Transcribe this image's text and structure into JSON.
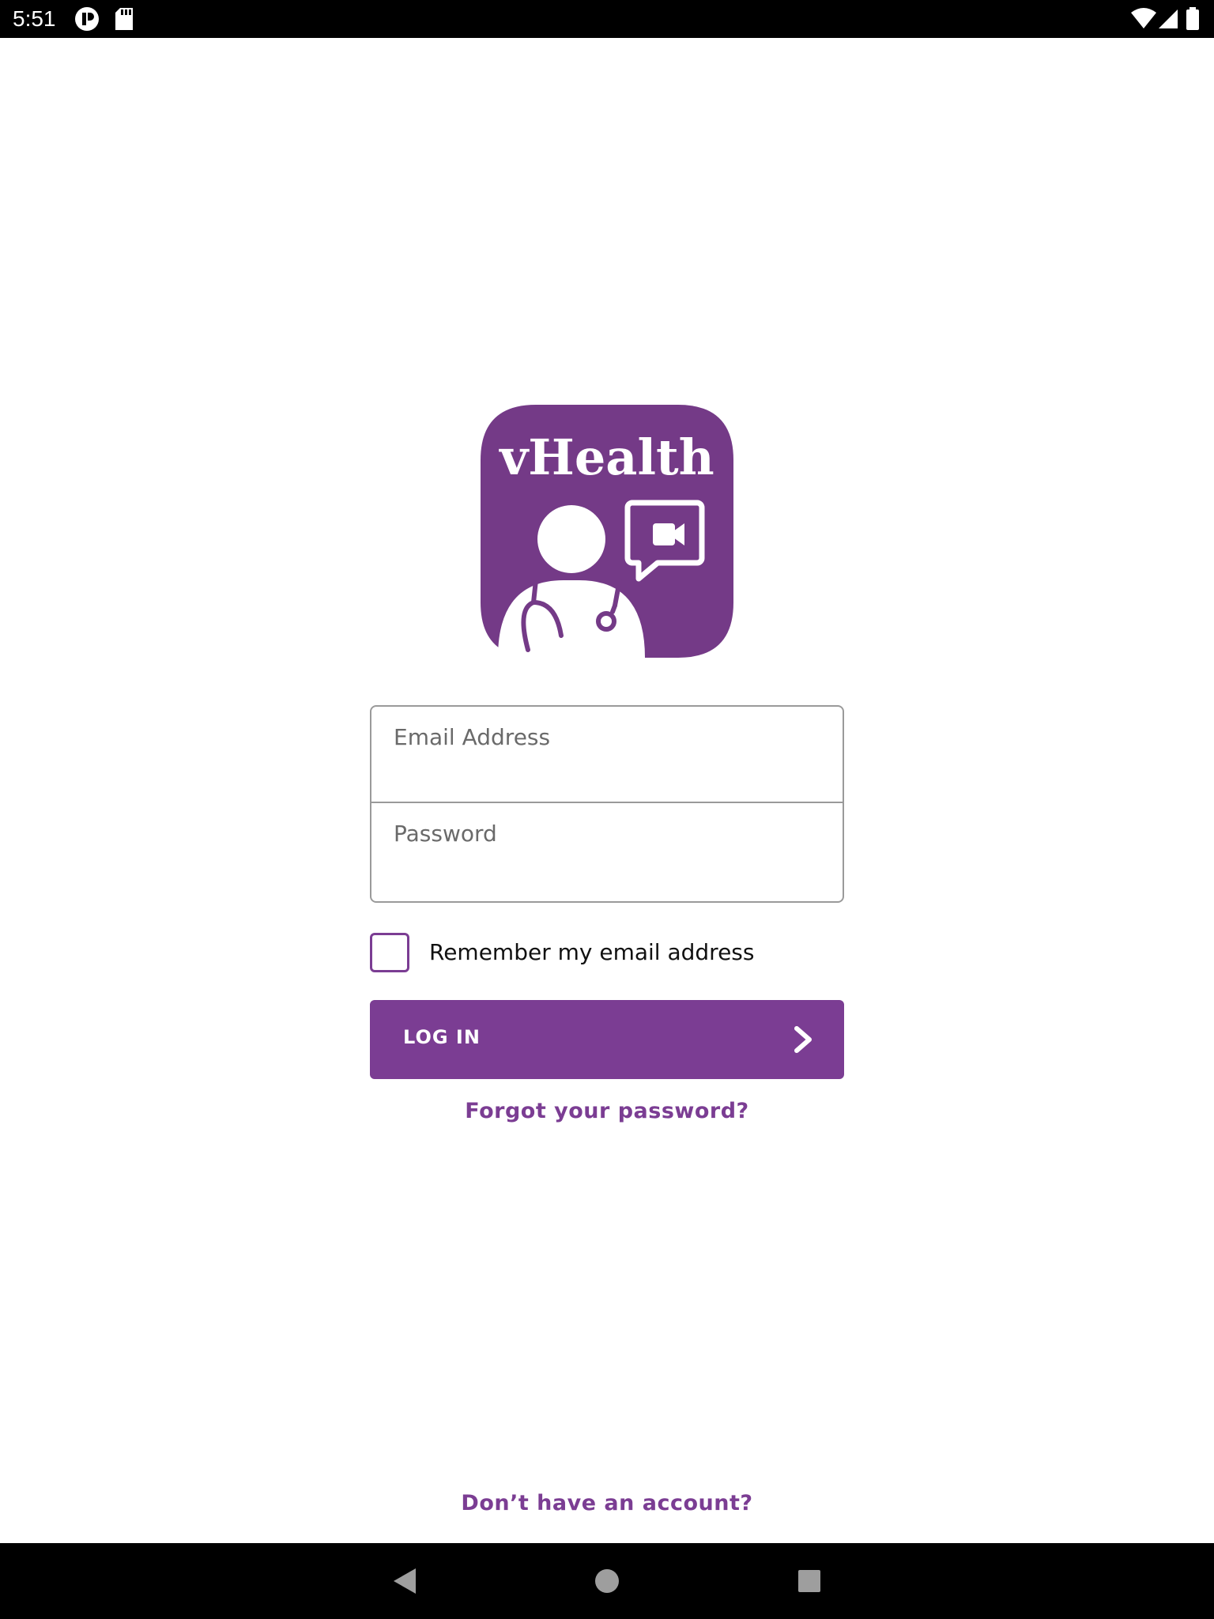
{
  "status_bar": {
    "time": "5:51"
  },
  "logo": {
    "text": "vHealth",
    "brand_color": "#743a87"
  },
  "form": {
    "email_placeholder": "Email Address",
    "password_placeholder": "Password",
    "remember_label": "Remember my email address",
    "remember_checked": false,
    "login_label": "LOG IN",
    "forgot_link": "Forgot your password?"
  },
  "footer": {
    "signup_link": "Don’t have an account?"
  },
  "colors": {
    "accent": "#7b3d93",
    "border": "#9a9a9a"
  },
  "icons": [
    "record-icon",
    "sd-card-icon",
    "wifi-icon",
    "cellular-signal-icon",
    "battery-icon",
    "stethoscope-doctor-icon",
    "video-chat-icon",
    "chevron-right-icon",
    "back-icon",
    "home-icon",
    "recents-icon"
  ]
}
